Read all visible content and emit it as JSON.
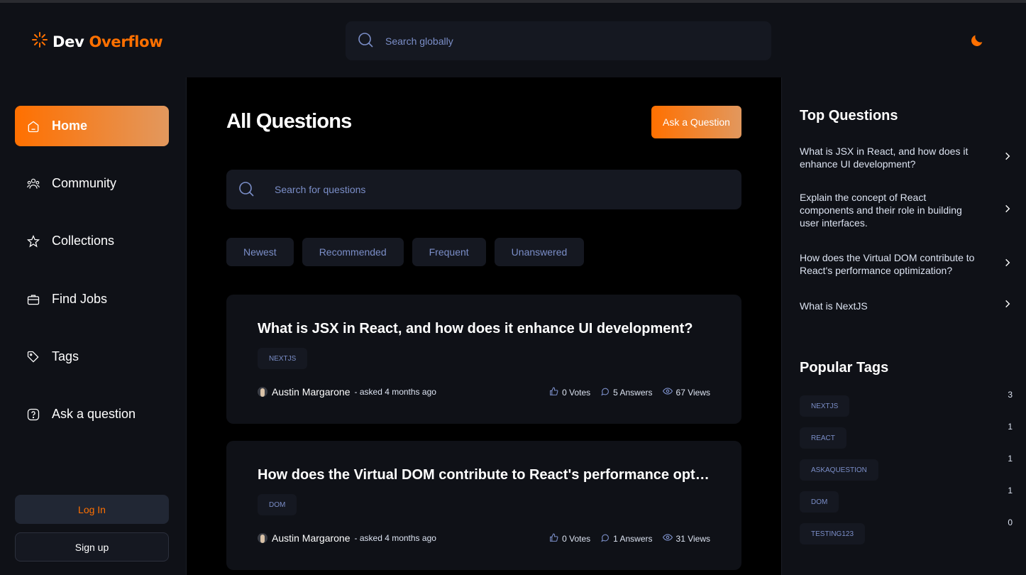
{
  "brand": {
    "name_part1": "Dev",
    "name_part2": "Overflow",
    "accent_color": "#ff7000"
  },
  "global_search": {
    "placeholder": "Search globally"
  },
  "theme_toggle": {
    "icon": "moon-icon"
  },
  "sidebar": {
    "items": [
      {
        "label": "Home",
        "icon": "home-icon",
        "active": true
      },
      {
        "label": "Community",
        "icon": "users-icon",
        "active": false
      },
      {
        "label": "Collections",
        "icon": "star-icon",
        "active": false
      },
      {
        "label": "Find Jobs",
        "icon": "suitcase-icon",
        "active": false
      },
      {
        "label": "Tags",
        "icon": "tag-icon",
        "active": false
      },
      {
        "label": "Ask a question",
        "icon": "question-icon",
        "active": false
      }
    ],
    "login_label": "Log In",
    "signup_label": "Sign up"
  },
  "main": {
    "title": "All Questions",
    "ask_button": "Ask a Question",
    "search_placeholder": "Search for questions",
    "filters": [
      "Newest",
      "Recommended",
      "Frequent",
      "Unanswered"
    ],
    "questions": [
      {
        "title": "What is JSX in React, and how does it enhance UI development?",
        "tags": [
          "NEXTJS"
        ],
        "author": "Austin Margarone",
        "asked": "- asked 4 months ago",
        "votes": "0 Votes",
        "answers": "5 Answers",
        "views": "67 Views"
      },
      {
        "title": "How does the Virtual DOM contribute to React's performance optimization?",
        "tags": [
          "DOM"
        ],
        "author": "Austin Margarone",
        "asked": "- asked 4 months ago",
        "votes": "0 Votes",
        "answers": "1 Answers",
        "views": "31 Views"
      }
    ]
  },
  "right_sidebar": {
    "top_questions_title": "Top Questions",
    "top_questions": [
      "What is JSX in React, and how does it enhance UI development?",
      "Explain the concept of React components and their role in building user interfaces.",
      "How does the Virtual DOM contribute to React's performance optimization?",
      "What is NextJS"
    ],
    "popular_tags_title": "Popular Tags",
    "popular_tags": [
      {
        "name": "NEXTJS",
        "count": "3"
      },
      {
        "name": "REACT",
        "count": "1"
      },
      {
        "name": "ASKAQUESTION",
        "count": "1"
      },
      {
        "name": "DOM",
        "count": "1"
      },
      {
        "name": "TESTING123",
        "count": "0"
      }
    ]
  }
}
